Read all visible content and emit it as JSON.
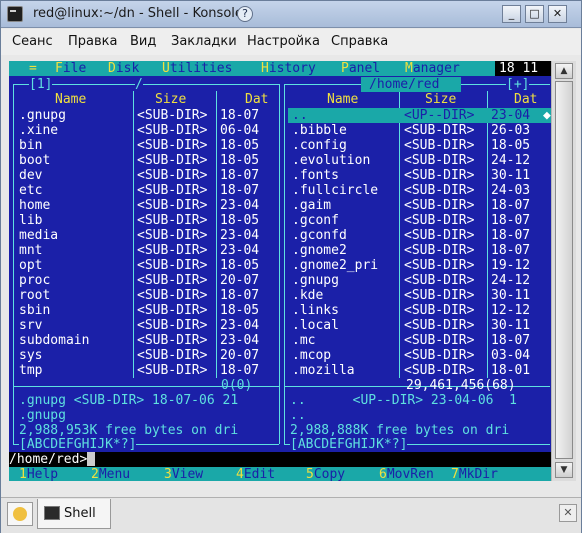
{
  "window": {
    "title": "red@linux:~/dn - Shell - Konsole"
  },
  "menubar": [
    "Сеанс",
    "Правка",
    "Вид",
    "Закладки",
    "Настройка",
    "Справка"
  ],
  "mc_menu": {
    "items": [
      {
        "pre": "= ",
        "hk": "",
        "rest": ""
      },
      {
        "pre": "",
        "hk": "F",
        "rest": "ile"
      },
      {
        "pre": "",
        "hk": "D",
        "rest": "isk"
      },
      {
        "pre": "",
        "hk": "U",
        "rest": "tilities"
      },
      {
        "pre": "",
        "hk": "H",
        "rest": "istory"
      },
      {
        "pre": "",
        "hk": "P",
        "rest": "anel"
      },
      {
        "pre": "",
        "hk": "M",
        "rest": "anager"
      }
    ],
    "clock": "18 11"
  },
  "left_panel": {
    "drive_tag": "[1]",
    "path": "/",
    "headers": [
      "Name",
      "Size",
      "Dat"
    ],
    "rows": [
      [
        ".gnupg",
        "<SUB-DIR>",
        "18-07"
      ],
      [
        ".xine",
        "<SUB-DIR>",
        "06-04"
      ],
      [
        "bin",
        "<SUB-DIR>",
        "18-05"
      ],
      [
        "boot",
        "<SUB-DIR>",
        "18-05"
      ],
      [
        "dev",
        "<SUB-DIR>",
        "18-07"
      ],
      [
        "etc",
        "<SUB-DIR>",
        "18-07"
      ],
      [
        "home",
        "<SUB-DIR>",
        "23-04"
      ],
      [
        "lib",
        "<SUB-DIR>",
        "18-05"
      ],
      [
        "media",
        "<SUB-DIR>",
        "23-04"
      ],
      [
        "mnt",
        "<SUB-DIR>",
        "23-04"
      ],
      [
        "opt",
        "<SUB-DIR>",
        "18-05"
      ],
      [
        "proc",
        "<SUB-DIR>",
        "20-07"
      ],
      [
        "root",
        "<SUB-DIR>",
        "18-07"
      ],
      [
        "sbin",
        "<SUB-DIR>",
        "18-05"
      ],
      [
        "srv",
        "<SUB-DIR>",
        "23-04"
      ],
      [
        "subdomain",
        "<SUB-DIR>",
        "23-04"
      ],
      [
        "sys",
        "<SUB-DIR>",
        "20-07"
      ],
      [
        "tmp",
        "<SUB-DIR>",
        "18-07"
      ]
    ],
    "total": "0(0)",
    "info1": ".gnupg <SUB-DIR> 18-07-06 21",
    "info2": ".gnupg",
    "free": "2,988,953K free bytes on dri",
    "filter": "[ABCDEFGHIJK*?]"
  },
  "right_panel": {
    "drive_tag": "[+]",
    "path": "/home/red",
    "headers": [
      "Name",
      "Size",
      "Dat"
    ],
    "rows": [
      [
        "..",
        "<UP--DIR>",
        "23-04"
      ],
      [
        ".bibble",
        "<SUB-DIR>",
        "26-03"
      ],
      [
        ".config",
        "<SUB-DIR>",
        "18-05"
      ],
      [
        ".evolution",
        "<SUB-DIR>",
        "24-12"
      ],
      [
        ".fonts",
        "<SUB-DIR>",
        "30-11"
      ],
      [
        ".fullcircle",
        "<SUB-DIR>",
        "24-03"
      ],
      [
        ".gaim",
        "<SUB-DIR>",
        "18-07"
      ],
      [
        ".gconf",
        "<SUB-DIR>",
        "18-07"
      ],
      [
        ".gconfd",
        "<SUB-DIR>",
        "18-07"
      ],
      [
        ".gnome2",
        "<SUB-DIR>",
        "18-07"
      ],
      [
        ".gnome2_pri",
        "<SUB-DIR>",
        "19-12"
      ],
      [
        ".gnupg",
        "<SUB-DIR>",
        "24-12"
      ],
      [
        ".kde",
        "<SUB-DIR>",
        "30-11"
      ],
      [
        ".links",
        "<SUB-DIR>",
        "12-12"
      ],
      [
        ".local",
        "<SUB-DIR>",
        "30-11"
      ],
      [
        ".mc",
        "<SUB-DIR>",
        "18-07"
      ],
      [
        ".mcop",
        "<SUB-DIR>",
        "03-04"
      ],
      [
        ".mozilla",
        "<SUB-DIR>",
        "18-01"
      ]
    ],
    "total": "29,461,456(68)",
    "info1": "..      <UP--DIR> 23-04-06  1",
    "info2": "..",
    "free": "2,988,888K free bytes on dri",
    "filter": "[ABCDEFGHIJK*?]"
  },
  "cmdline": "/home/red>",
  "fkeys": [
    {
      "num": "1",
      "label": "Help"
    },
    {
      "num": "2",
      "label": "Menu"
    },
    {
      "num": "3",
      "label": "View"
    },
    {
      "num": "4",
      "label": "Edit"
    },
    {
      "num": "5",
      "label": "Copy"
    },
    {
      "num": "6",
      "label": "MovRen"
    },
    {
      "num": "7",
      "label": "MkDir"
    }
  ],
  "tab": {
    "label": "Shell"
  }
}
